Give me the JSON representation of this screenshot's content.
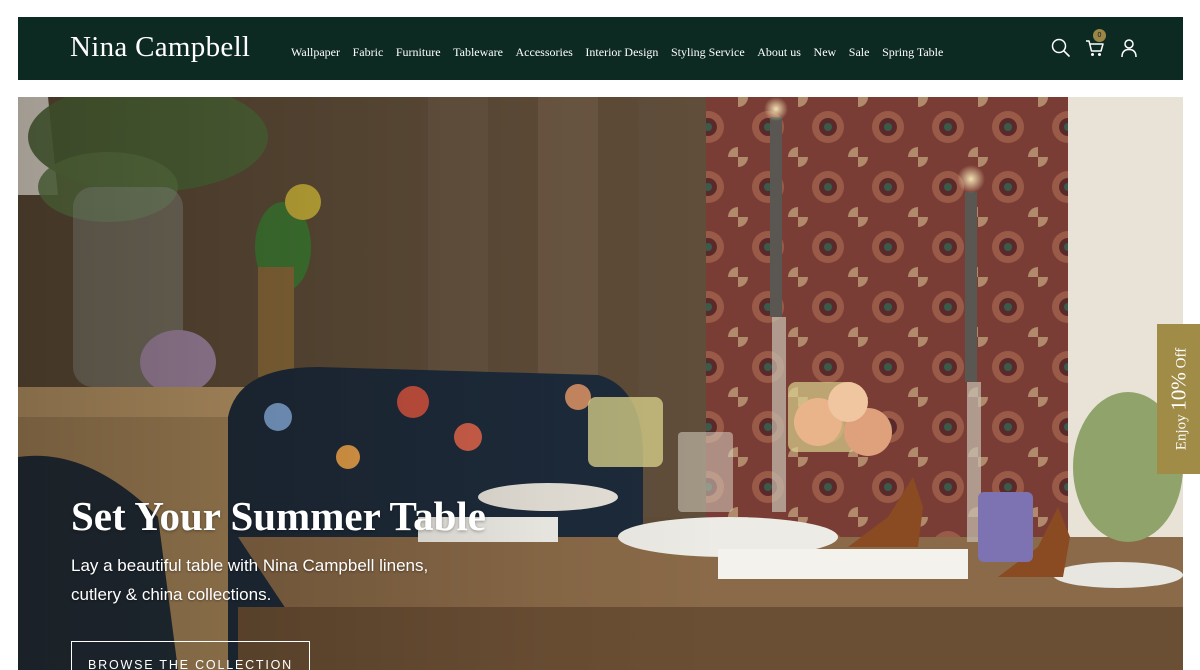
{
  "brand": {
    "name": "Nina Campbell"
  },
  "nav": {
    "items": [
      {
        "label": "Wallpaper"
      },
      {
        "label": "Fabric"
      },
      {
        "label": "Furniture"
      },
      {
        "label": "Tableware"
      },
      {
        "label": "Accessories"
      },
      {
        "label": "Interior Design"
      },
      {
        "label": "Styling Service"
      },
      {
        "label": "About us"
      },
      {
        "label": "New"
      },
      {
        "label": "Sale"
      },
      {
        "label": "Spring Table"
      }
    ]
  },
  "header_icons": {
    "search": "search-icon",
    "cart": "cart-icon",
    "account": "user-icon",
    "cart_count": "0"
  },
  "hero": {
    "title": "Set Your Summer Table",
    "subtitle": "Lay a beautiful table with Nina Campbell linens, cutlery & china collections.",
    "cta": "BROWSE THE COLLECTION"
  },
  "promo_tab": {
    "prefix": "Enjoy ",
    "amount": "10%",
    "suffix": " Off"
  },
  "colors": {
    "header_bg": "#0d2a22",
    "promo_bg": "#a08b47",
    "badge": "#9a8747"
  }
}
